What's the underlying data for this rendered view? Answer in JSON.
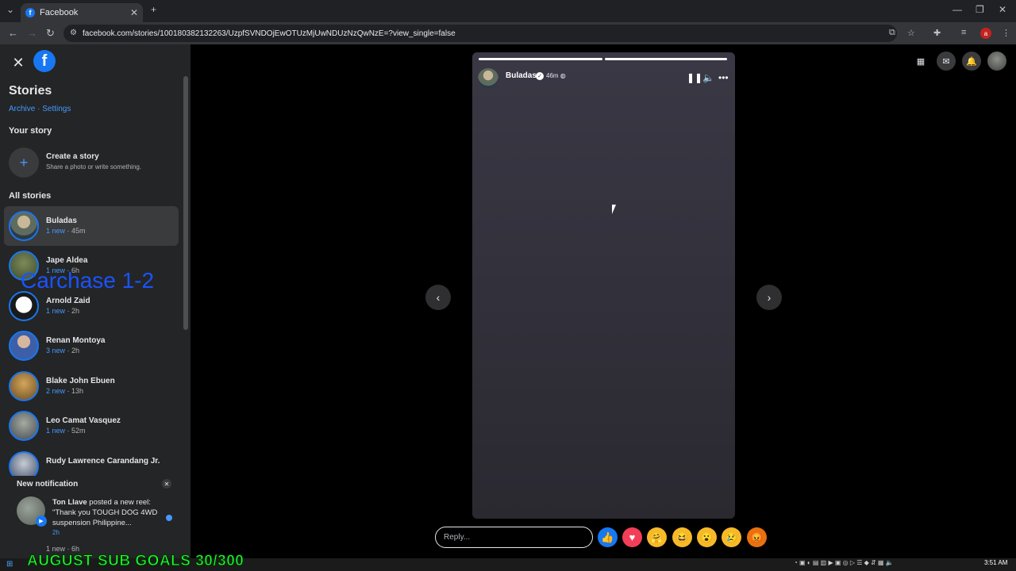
{
  "browser": {
    "tab_title": "Facebook",
    "url": "facebook.com/stories/100180382132263/UzpfSVNDOjEwOTUzMjUwNDUzNzQwNzE=?view_single=false"
  },
  "sidebar": {
    "title": "Stories",
    "links": "Archive · Settings",
    "your_story_label": "Your story",
    "create_title": "Create a story",
    "create_sub": "Share a photo or write something.",
    "all_stories_label": "All stories",
    "stories": [
      {
        "name": "Buladas",
        "new": "1 new",
        "time": " · 45m"
      },
      {
        "name": "Jape Aldea",
        "new": "1 new",
        "time": " · 6h"
      },
      {
        "name": "Arnold Zaid",
        "new": "1 new",
        "time": " · 2h"
      },
      {
        "name": "Renan Montoya",
        "new": "3 new",
        "time": " · 2h"
      },
      {
        "name": "Blake John Ebuen",
        "new": "2 new",
        "time": " · 13h"
      },
      {
        "name": "Leo Camat Vasquez",
        "new": "1 new",
        "time": " · 52m"
      },
      {
        "name": "Rudy Lawrence Carandang Jr.",
        "new": "",
        "time": ""
      }
    ],
    "last_item_meta": "1 new · 6h"
  },
  "overlay_text": "Carchase 1-2",
  "notification": {
    "title": "New notification",
    "actor": "Ton Llave",
    "text": " posted a new reel: \"Thank you TOUGH DOG 4WD suspension Philippine...",
    "time": "2h"
  },
  "viewer": {
    "author": "Buladas",
    "time": "46m",
    "reply_placeholder": "Reply..."
  },
  "stream_overlay": "AUGUST SUB GOALS 30/300",
  "taskbar": {
    "clock": "3:51 AM"
  },
  "colors": {
    "accent": "#1877f2",
    "link": "#4599ff",
    "sidebar_bg": "#242526",
    "overlay_green": "#22ff33"
  }
}
